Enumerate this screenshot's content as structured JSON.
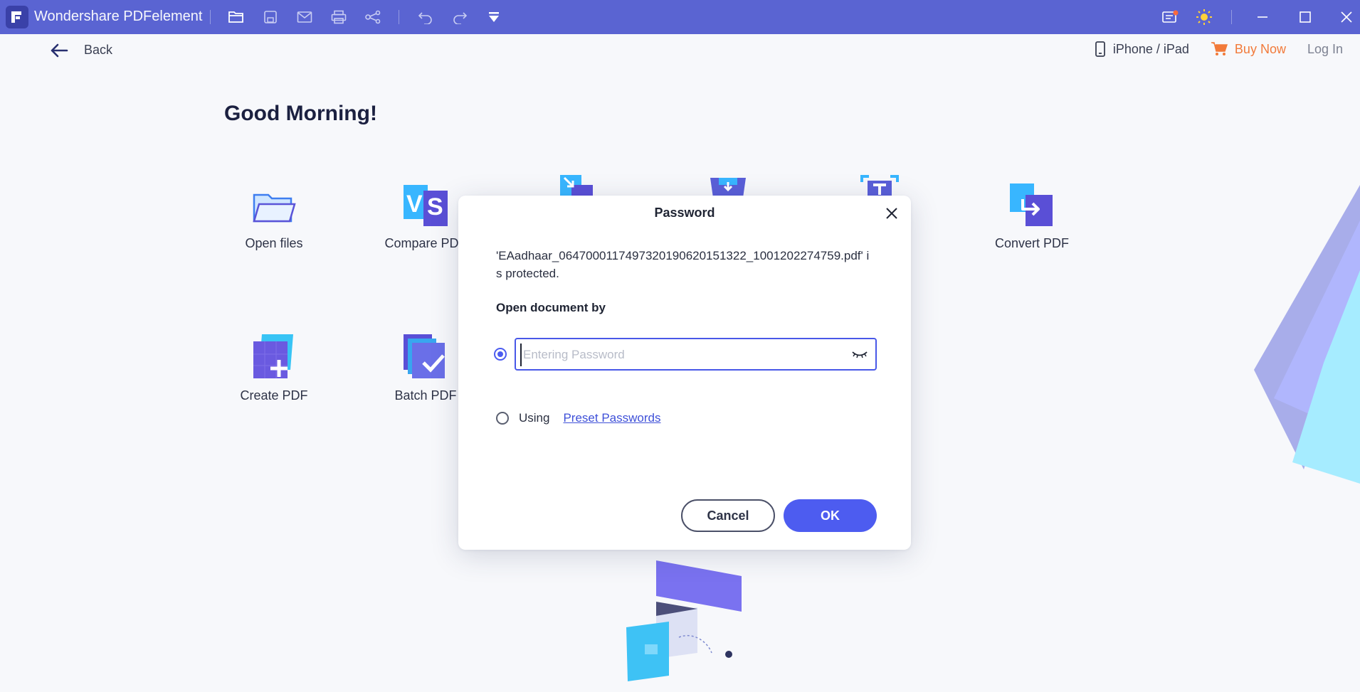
{
  "app": {
    "title": "Wondershare PDFelement"
  },
  "toolbar": {
    "icons": [
      "open-folder-icon",
      "save-icon",
      "mail-icon",
      "print-icon",
      "share-icon",
      "undo-icon",
      "redo-icon",
      "quick-access-dropdown-icon"
    ],
    "right_icons": [
      "notification-icon",
      "theme-sun-icon",
      "minimize-icon",
      "maximize-icon",
      "close-icon"
    ]
  },
  "nav": {
    "back_label": "Back",
    "device_label": "iPhone / iPad",
    "buy_label": "Buy Now",
    "login_label": "Log In"
  },
  "home": {
    "greeting": "Good Morning!",
    "tools": [
      {
        "label": "Open files",
        "icon": "folder-icon"
      },
      {
        "label": "Compare PDF",
        "icon": "compare-icon"
      },
      {
        "label": "",
        "icon": "combine-icon"
      },
      {
        "label": "",
        "icon": "template-icon"
      },
      {
        "label": "",
        "icon": "ocr-icon"
      },
      {
        "label": "Convert PDF",
        "icon": "convert-icon"
      },
      {
        "label": "Create PDF",
        "icon": "create-icon"
      },
      {
        "label": "Batch PDF",
        "icon": "batch-icon"
      }
    ]
  },
  "dialog": {
    "title": "Password",
    "message": "'EAadhaar_0647000117497320190620151322_1001202274759.pdf' is protected.",
    "section_label": "Open document by",
    "password_placeholder": "Entering Password",
    "password_value": "",
    "using_label": "Using",
    "preset_link": "Preset Passwords",
    "cancel_label": "Cancel",
    "ok_label": "OK",
    "selected_option": "password"
  },
  "colors": {
    "titlebar": "#5a64d2",
    "accent": "#4d5cf0",
    "buy": "#f27a3a"
  }
}
